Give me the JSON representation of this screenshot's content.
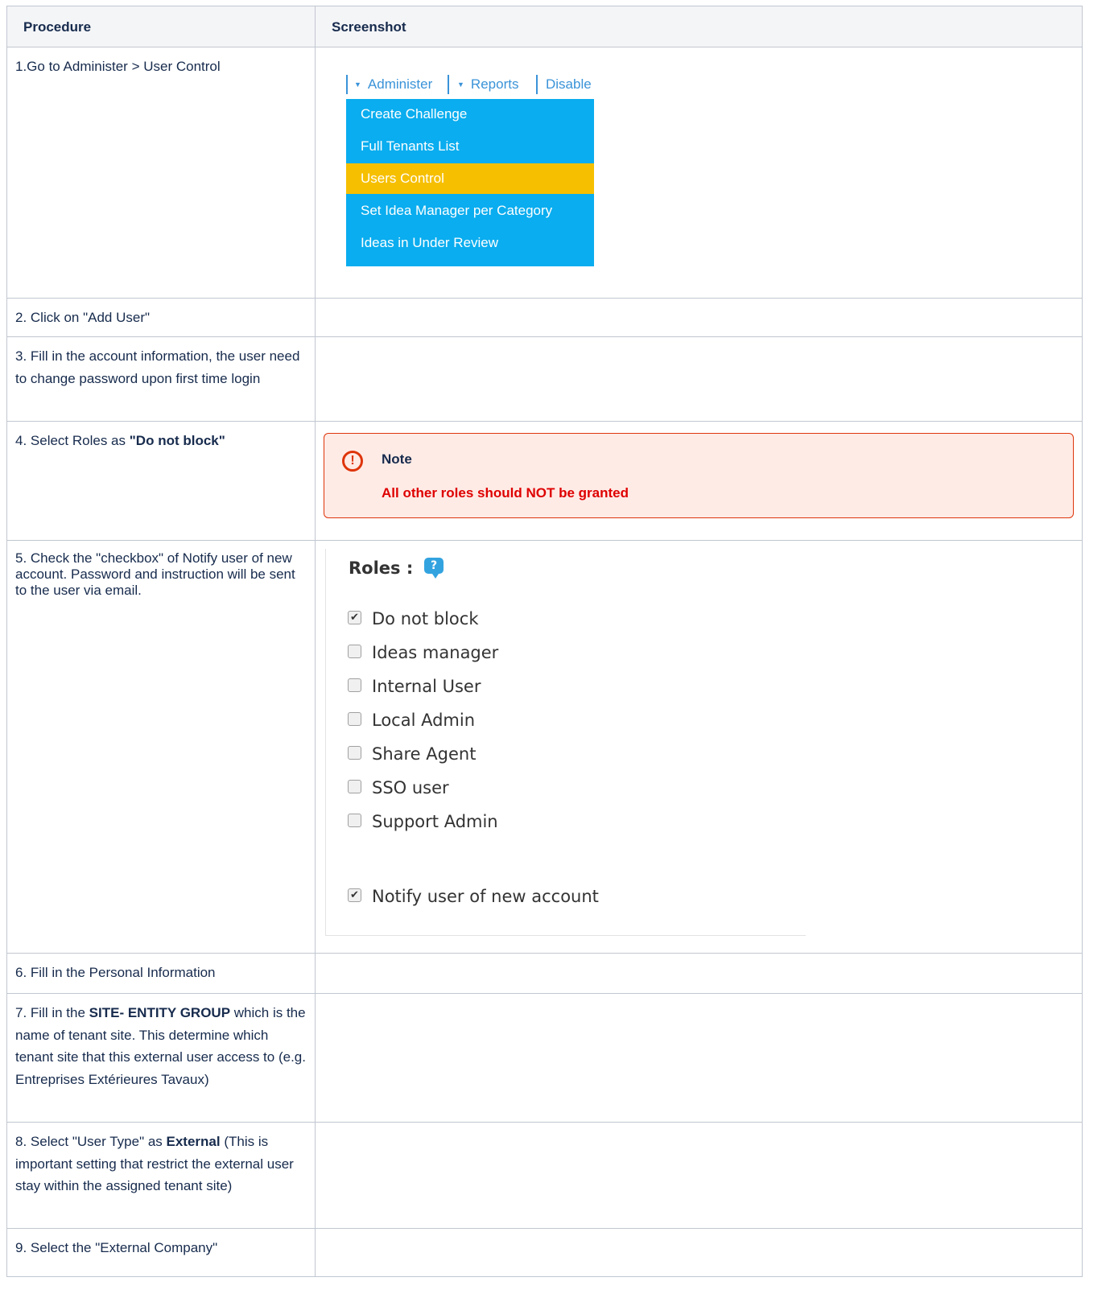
{
  "table": {
    "headers": {
      "procedure": "Procedure",
      "screenshot": "Screenshot"
    },
    "rows": [
      {
        "step": "1.Go to Administer > User Control"
      },
      {
        "step": "2. Click on \"Add User\""
      },
      {
        "step": "3. Fill in the account information, the user need to change password upon first time login"
      },
      {
        "step_pre": "4. Select Roles as ",
        "step_bold": "\"Do not block\""
      },
      {
        "step": "5. Check the \"checkbox\" of Notify user of new account. Password and instruction will be sent to the user via email."
      },
      {
        "step": "6. Fill in the Personal Information"
      },
      {
        "step_pre": "7. Fill in the ",
        "step_bold": "SITE- ENTITY GROUP",
        "step_post": " which is the name of tenant site. This determine which tenant site that this external user access to (e.g. Entreprises Extérieures Tavaux)"
      },
      {
        "step_pre": "8. Select \"User Type\" as ",
        "step_bold": "External",
        "step_post": " (This is important setting that restrict the external user stay within the assigned tenant site)"
      },
      {
        "step": "9. Select the \"External Company\""
      }
    ]
  },
  "menu_screenshot": {
    "menubar": [
      "Administer",
      "Reports",
      "Disable"
    ],
    "items": [
      "Create Challenge",
      "Full Tenants List",
      "Users Control",
      "Set Idea Manager per Category",
      "Ideas in Under Review"
    ],
    "active_index": 2,
    "colors": {
      "menu_bg": "#0aadef",
      "active_bg": "#f6bf00",
      "link": "#3a93d8"
    }
  },
  "note": {
    "title": "Note",
    "body": "All other roles should NOT be granted",
    "icon": "exclamation-circle-icon",
    "colors": {
      "border": "#de350b",
      "bg": "#ffebe6",
      "text": "#de0000"
    }
  },
  "roles_screenshot": {
    "title": "Roles :",
    "help_icon": "?",
    "roles": [
      {
        "label": "Do not block",
        "checked": true
      },
      {
        "label": "Ideas manager",
        "checked": false
      },
      {
        "label": "Internal User",
        "checked": false
      },
      {
        "label": "Local Admin",
        "checked": false
      },
      {
        "label": "Share Agent",
        "checked": false
      },
      {
        "label": "SSO user",
        "checked": false
      },
      {
        "label": "Support Admin",
        "checked": false
      }
    ],
    "notify": {
      "label": "Notify user of new account",
      "checked": true
    }
  }
}
